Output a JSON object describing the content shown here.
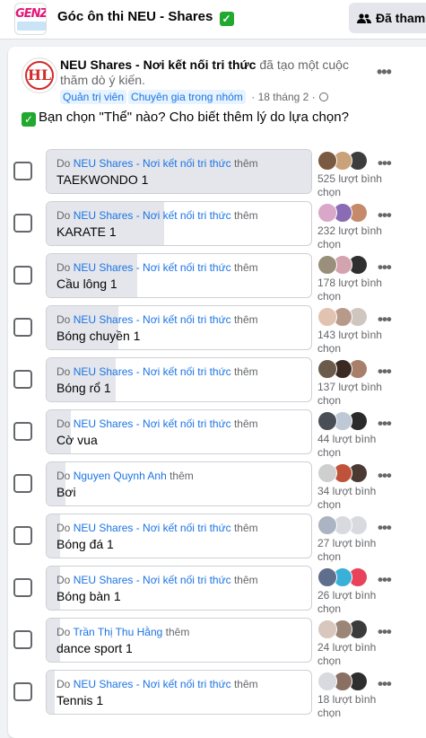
{
  "group": {
    "logo_text": "GENZ",
    "title": "Góc ôn thi NEU - Shares",
    "title_emoji": "✓",
    "joined_label": "Đã tham"
  },
  "post": {
    "avatar_text": "HL",
    "author": "NEU Shares - Nơi kết nối tri thức",
    "action": "đã tạo một cuộc thăm dò ý kiến.",
    "badges": [
      "Quản trị viên",
      "Chuyên gia trong nhóm"
    ],
    "time": "· 18 tháng 2 ·",
    "question_emoji": "✓",
    "question": "Bạn chọn \"Thể\" nào? Cho biết thêm lý do lựa chọn?",
    "more": "•••"
  },
  "poll": {
    "added_prefix": "Do",
    "added_suffix": "thêm",
    "options": [
      {
        "who": "NEU Shares - Nơi kết nối tri thức",
        "label": "TAEKWONDO 1",
        "votes_text": "525 lượt bình chọn",
        "votes": 525,
        "fill": 1.0,
        "avatar_colors": [
          "#7a5a40",
          "#c9a27a",
          "#3d3d3d"
        ]
      },
      {
        "who": "NEU Shares - Nơi kết nối tri thức",
        "label": "KARATE 1",
        "votes_text": "232 lượt bình chọn",
        "votes": 232,
        "fill": 0.44,
        "avatar_colors": [
          "#d9a7c7",
          "#8a6bb5",
          "#c58a6a"
        ]
      },
      {
        "who": "NEU Shares - Nơi kết nối tri thức",
        "label": "Cầu lông 1",
        "votes_text": "178 lượt bình chọn",
        "votes": 178,
        "fill": 0.34,
        "avatar_colors": [
          "#9a8f7a",
          "#d4a3b0",
          "#2f2f2f"
        ]
      },
      {
        "who": "NEU Shares - Nơi kết nối tri thức",
        "label": "Bóng chuyền 1",
        "votes_text": "143 lượt bình chọn",
        "votes": 143,
        "fill": 0.27,
        "avatar_colors": [
          "#e2c2b0",
          "#b89a8a",
          "#cfc6c0"
        ]
      },
      {
        "who": "NEU Shares - Nơi kết nối tri thức",
        "label": "Bóng rổ 1",
        "votes_text": "137 lượt bình chọn",
        "votes": 137,
        "fill": 0.26,
        "avatar_colors": [
          "#6b5b4b",
          "#3a2a22",
          "#a87f6a"
        ]
      },
      {
        "who": "NEU Shares - Nơi kết nối tri thức",
        "label": "Cờ vua",
        "votes_text": "44 lượt bình chọn",
        "votes": 44,
        "fill": 0.09,
        "avatar_colors": [
          "#4a4f57",
          "#bfc8d6",
          "#2b2b2b"
        ]
      },
      {
        "who": "Nguyen Quynh Anh",
        "label": "Bơi",
        "votes_text": "34 lượt bình chọn",
        "votes": 34,
        "fill": 0.07,
        "avatar_colors": [
          "#cfcfcf",
          "#c0523a",
          "#4b3a34"
        ]
      },
      {
        "who": "NEU Shares - Nơi kết nối tri thức",
        "label": "Bóng đá 1",
        "votes_text": "27 lượt bình chọn",
        "votes": 27,
        "fill": 0.05,
        "avatar_colors": [
          "#aab4c2",
          "#d8dadf",
          "#d8dadf"
        ]
      },
      {
        "who": "NEU Shares - Nơi kết nối tri thức",
        "label": "Bóng bàn 1",
        "votes_text": "26 lượt bình chọn",
        "votes": 26,
        "fill": 0.05,
        "avatar_colors": [
          "#5f6e8c",
          "#3ab0d8",
          "#e8435a"
        ]
      },
      {
        "who": "Trần Thị Thu Hằng",
        "label": "dance sport 1",
        "votes_text": "24 lượt bình chọn",
        "votes": 24,
        "fill": 0.05,
        "avatar_colors": [
          "#d7c7bd",
          "#9b8577",
          "#3b3b3b"
        ]
      },
      {
        "who": "NEU Shares - Nơi kết nối tri thức",
        "label": "Tennis 1",
        "votes_text": "18 lượt bình chọn",
        "votes": 18,
        "fill": 0.03,
        "avatar_colors": [
          "#d8dadf",
          "#8a6f63",
          "#2e2e2e"
        ]
      }
    ],
    "option_more": "•••"
  },
  "colors": {
    "accent": "#1b74e4",
    "fill": "#e4e6eb",
    "muted": "#65676b"
  }
}
